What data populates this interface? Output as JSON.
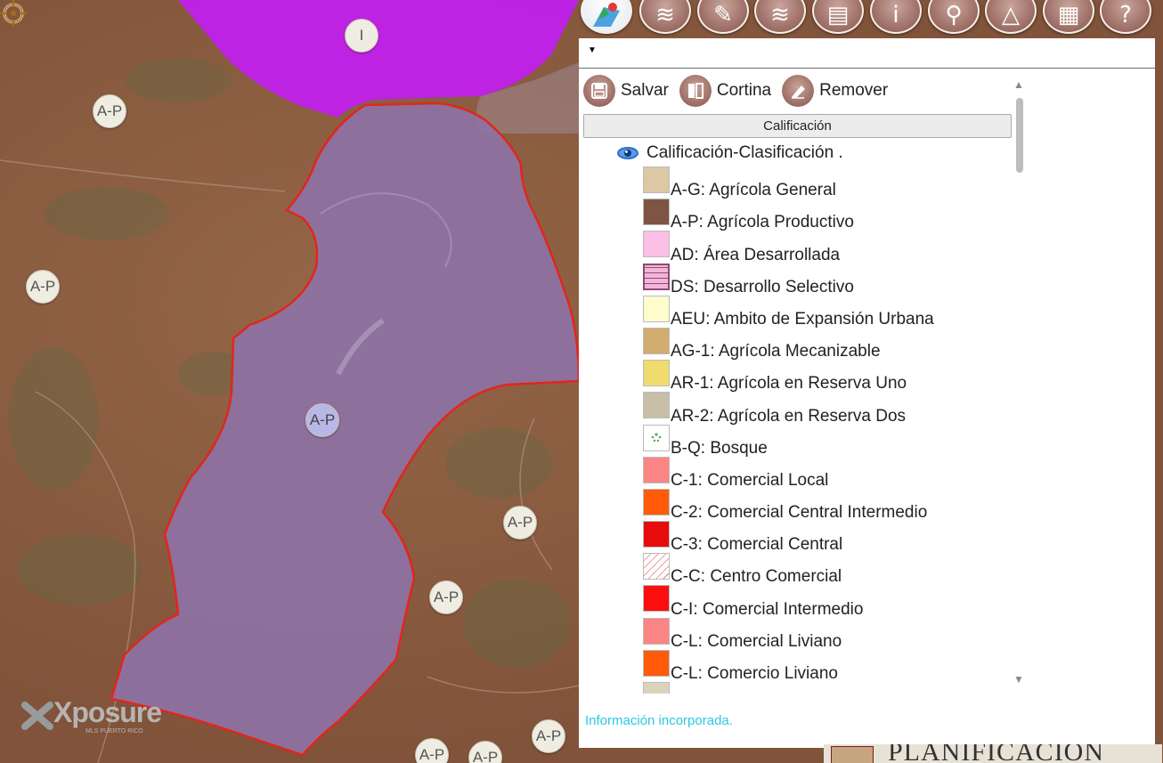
{
  "map": {
    "zone_labels": [
      {
        "text": "I"
      },
      {
        "text": "A-P"
      },
      {
        "text": "A-P"
      },
      {
        "text": "A-P"
      },
      {
        "text": "A-P"
      },
      {
        "text": "A-P"
      },
      {
        "text": "A-P"
      },
      {
        "text": "A-P"
      },
      {
        "text": "A-P"
      }
    ],
    "selected_label": "A-P",
    "watermark": {
      "text": "Xposure",
      "subtext": "MLS PUERTO RICO"
    },
    "colors": {
      "terrain": "#8a5a3e",
      "parcel_fill": "#8e72a6",
      "parcel_stroke": "#e1261c",
      "zone_i": "#c21df0"
    }
  },
  "toolbar": {
    "buttons": [
      {
        "icon": "map-pin-icon"
      },
      {
        "icon": "layers-icon"
      },
      {
        "icon": "eraser-icon"
      },
      {
        "icon": "layers-stack-icon"
      },
      {
        "icon": "document-icon"
      },
      {
        "icon": "info-icon"
      },
      {
        "icon": "search-icon"
      },
      {
        "icon": "measure-icon"
      },
      {
        "icon": "print-icon"
      },
      {
        "icon": "help-icon"
      }
    ]
  },
  "panel": {
    "tools": {
      "save": "Salvar",
      "curtain": "Cortina",
      "remove": "Remover"
    },
    "section_header": "Calificación",
    "layer_title": "Calificación-Clasificación .",
    "legend": [
      {
        "label": "A-G: Agrícola General",
        "color": "#dcc8a5"
      },
      {
        "label": "A-P: Agrícola Productivo",
        "color": "#7e5545"
      },
      {
        "label": "AD: Área Desarrollada",
        "color": "#fcbfe6"
      },
      {
        "label": "DS: Desarrollo Selectivo",
        "color": "#f4b6d8"
      },
      {
        "label": "AEU: Ambito de Expansión Urbana",
        "color": "#fffccd"
      },
      {
        "label": "AG-1: Agrícola Mecanizable",
        "color": "#d2ad6f"
      },
      {
        "label": "AR-1: Agrícola en Reserva Uno",
        "color": "#f0dc6e"
      },
      {
        "label": "AR-2: Agrícola en Reserva Dos",
        "color": "#c9bea6"
      },
      {
        "label": "B-Q: Bosque",
        "color": "#ffffff"
      },
      {
        "label": "C-1: Comercial Local",
        "color": "#fb8585"
      },
      {
        "label": "C-2: Comercial Central Intermedio",
        "color": "#ff5b0a"
      },
      {
        "label": "C-3: Comercial Central",
        "color": "#e80b0b"
      },
      {
        "label": "C-C: Centro Comercial",
        "color": "#ffffff"
      },
      {
        "label": "C-I: Comercial Intermedio",
        "color": "#fb0f0f"
      },
      {
        "label": "C-L: Comercial Liviano",
        "color": "#fb8585"
      },
      {
        "label": "C-L: Comercio Liviano",
        "color": "#ff5b0a"
      },
      {
        "label": "",
        "color": "#dcd3bd"
      }
    ],
    "status": "Información incorporada."
  },
  "footer": {
    "logo_text": "PLANIFICACIÓN"
  }
}
